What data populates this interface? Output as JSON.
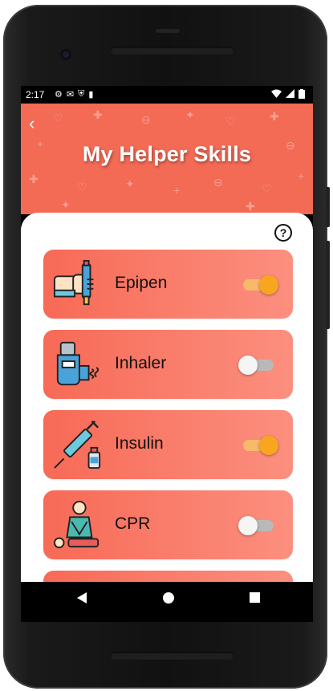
{
  "status_bar": {
    "time": "2:17",
    "left_icons": [
      "gear-icon",
      "mail-icon",
      "shield-icon",
      "sd-card-icon"
    ],
    "right_icons": [
      "wifi-icon",
      "signal-icon",
      "battery-icon"
    ]
  },
  "header": {
    "title": "My Helper Skills",
    "background_color": "#f36a55"
  },
  "help_button": {
    "label": "?"
  },
  "skills": [
    {
      "label": "Epipen",
      "icon": "epipen-icon",
      "enabled": true
    },
    {
      "label": "Inhaler",
      "icon": "inhaler-icon",
      "enabled": false
    },
    {
      "label": "Insulin",
      "icon": "insulin-syringe-icon",
      "enabled": true
    },
    {
      "label": "CPR",
      "icon": "cpr-icon",
      "enabled": false
    }
  ],
  "colors": {
    "accent_toggle_on": "#f9a51f",
    "card_gradient_start": "#f76a56",
    "card_gradient_end": "#fc8f7f"
  },
  "nav_bar": {
    "buttons": [
      "back-triangle-icon",
      "home-circle-icon",
      "recents-square-icon"
    ]
  }
}
